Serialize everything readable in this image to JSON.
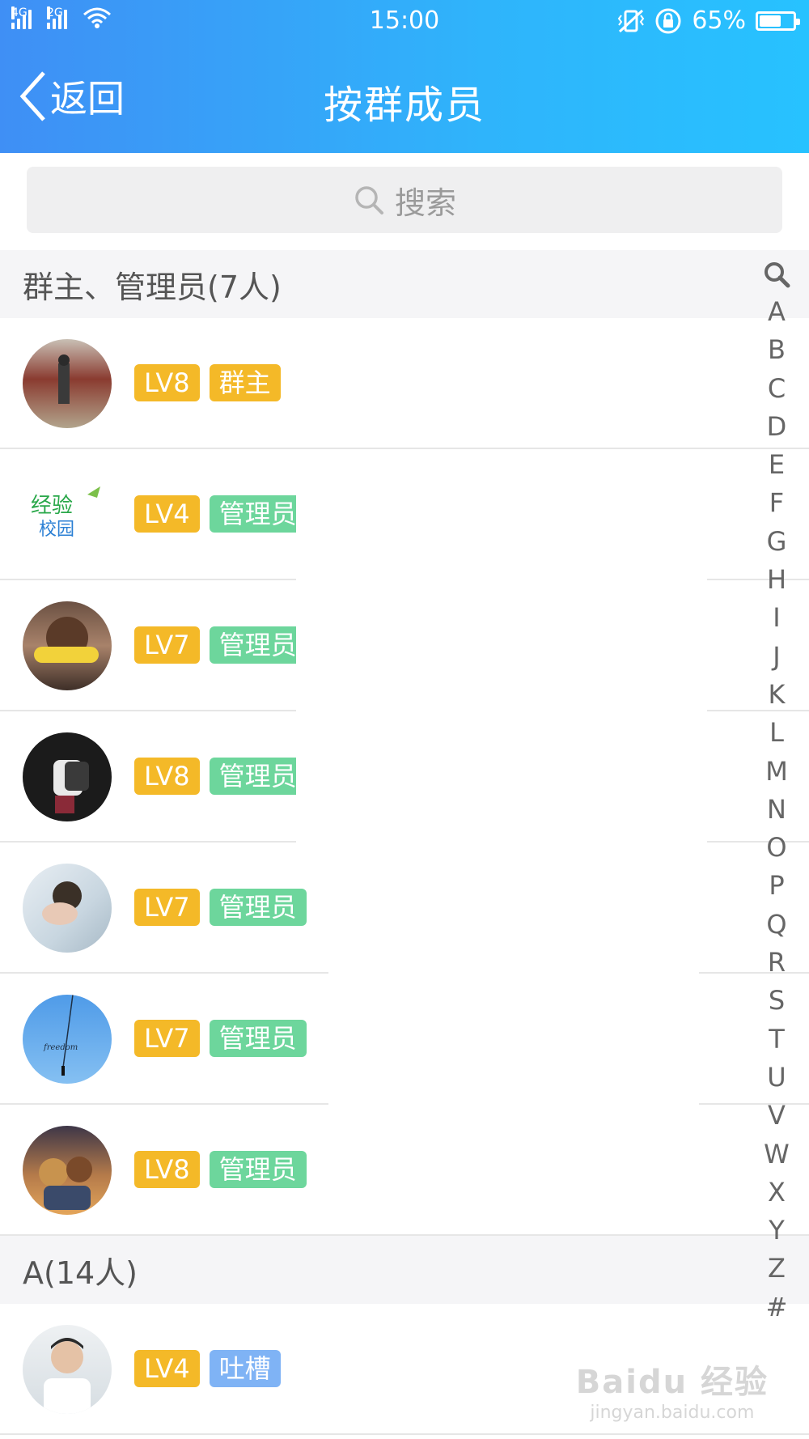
{
  "status_bar": {
    "network_left": "4G",
    "network_right": "2G",
    "time": "15:00",
    "battery_percent": "65%",
    "battery_level": 0.65
  },
  "nav": {
    "back_label": "返回",
    "title": "按群成员"
  },
  "search": {
    "placeholder": "搜索"
  },
  "sections": [
    {
      "label": "群主、管理员(7人)"
    },
    {
      "label": "A(14人)"
    }
  ],
  "members": [
    {
      "level": "LV8",
      "role": "群主",
      "role_type": "owner",
      "avatar_icon": "photo-man-street"
    },
    {
      "level": "LV4",
      "role": "管理员",
      "role_type": "admin",
      "avatar_icon": "logo-jingyan-xiaoyuan"
    },
    {
      "level": "LV7",
      "role": "管理员",
      "role_type": "admin",
      "avatar_icon": "photo-child-corn"
    },
    {
      "level": "LV8",
      "role": "管理员",
      "role_type": "admin",
      "avatar_icon": "photo-backpack"
    },
    {
      "level": "LV7",
      "role": "管理员",
      "role_type": "admin",
      "avatar_icon": "photo-girl-hand"
    },
    {
      "level": "LV7",
      "role": "管理员",
      "role_type": "admin",
      "avatar_icon": "photo-freedom-sky"
    },
    {
      "level": "LV8",
      "role": "管理员",
      "role_type": "admin",
      "avatar_icon": "cartoon-friends"
    },
    {
      "level": "LV4",
      "role": "吐槽",
      "role_type": "tucao",
      "avatar_icon": "photo-man-white"
    }
  ],
  "alphabet": [
    "A",
    "B",
    "C",
    "D",
    "E",
    "F",
    "G",
    "H",
    "I",
    "J",
    "K",
    "L",
    "M",
    "N",
    "O",
    "P",
    "Q",
    "R",
    "S",
    "T",
    "U",
    "V",
    "W",
    "X",
    "Y",
    "Z",
    "#"
  ],
  "watermark": {
    "top": "Baidu 经验",
    "bottom": "jingyan.baidu.com"
  },
  "colors": {
    "header_start": "#3f8ff5",
    "header_end": "#27c2ff",
    "level_badge": "#f4b928",
    "admin_badge": "#6dd69c",
    "tucao_badge": "#7fb3f5"
  }
}
